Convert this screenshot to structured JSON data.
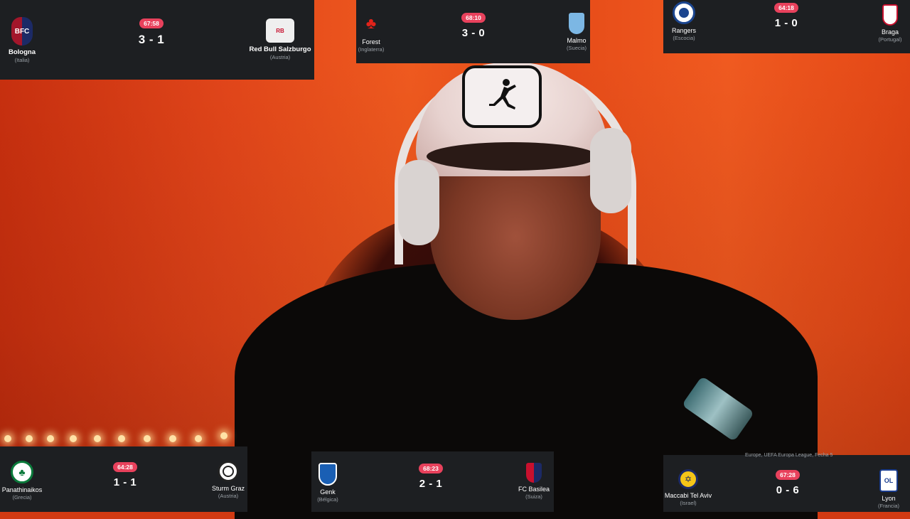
{
  "matches": [
    {
      "id": "bologna-salzburg",
      "time": "67:58",
      "score": "3 - 1",
      "home": {
        "name": "Bologna",
        "country": "(Italia)",
        "crest": "bologna-crest-icon",
        "color": "#a3162b"
      },
      "away": {
        "name": "Red Bull Salzburgo",
        "country": "(Austria)",
        "crest": "red-bull-crest-icon",
        "color": "#d6d6d6"
      }
    },
    {
      "id": "forest-malmo",
      "time": "68:10",
      "score": "3 - 0",
      "home": {
        "name": "Forest",
        "country": "(Inglaterra)",
        "crest": "forest-crest-icon",
        "color": "#c8102e"
      },
      "away": {
        "name": "Malmo",
        "country": "(Suecia)",
        "crest": "malmo-crest-icon",
        "color": "#7cb7e4"
      }
    },
    {
      "id": "rangers-braga",
      "time": "64:18",
      "score": "1 - 0",
      "home": {
        "name": "Rangers",
        "country": "(Escocia)",
        "crest": "rangers-crest-icon",
        "color": "#1b458f"
      },
      "away": {
        "name": "Braga",
        "country": "(Portugal)",
        "crest": "braga-crest-icon",
        "color": "#c8102e"
      }
    },
    {
      "id": "panathinaikos-sturm",
      "time": "64:28",
      "score": "1 - 1",
      "home": {
        "name": "Panathinaikos",
        "country": "(Grecia)",
        "crest": "panathinaikos-crest-icon",
        "color": "#0b7a3b"
      },
      "away": {
        "name": "Sturm Graz",
        "country": "(Austria)",
        "crest": "sturm-graz-crest-icon",
        "color": "#222222"
      }
    },
    {
      "id": "genk-basilea",
      "time": "68:23",
      "score": "2 - 1",
      "home": {
        "name": "Genk",
        "country": "(Bélgica)",
        "crest": "genk-crest-icon",
        "color": "#1a5fb4"
      },
      "away": {
        "name": "FC Basilea",
        "country": "(Suiza)",
        "crest": "basilea-crest-icon",
        "color": "#c8102e"
      }
    },
    {
      "id": "maccabi-lyon",
      "time": "67:28",
      "score": "0 - 6",
      "home": {
        "name": "Maccabi Tel Aviv",
        "country": "(Israel)",
        "crest": "maccabi-crest-icon",
        "color": "#1c2a66"
      },
      "away": {
        "name": "Lyon",
        "country": "(Francia)",
        "crest": "lyon-crest-icon",
        "color": "#1a3d8f"
      }
    }
  ],
  "competition_caption": "Europe, UEFA Europa League, Fecha 5"
}
